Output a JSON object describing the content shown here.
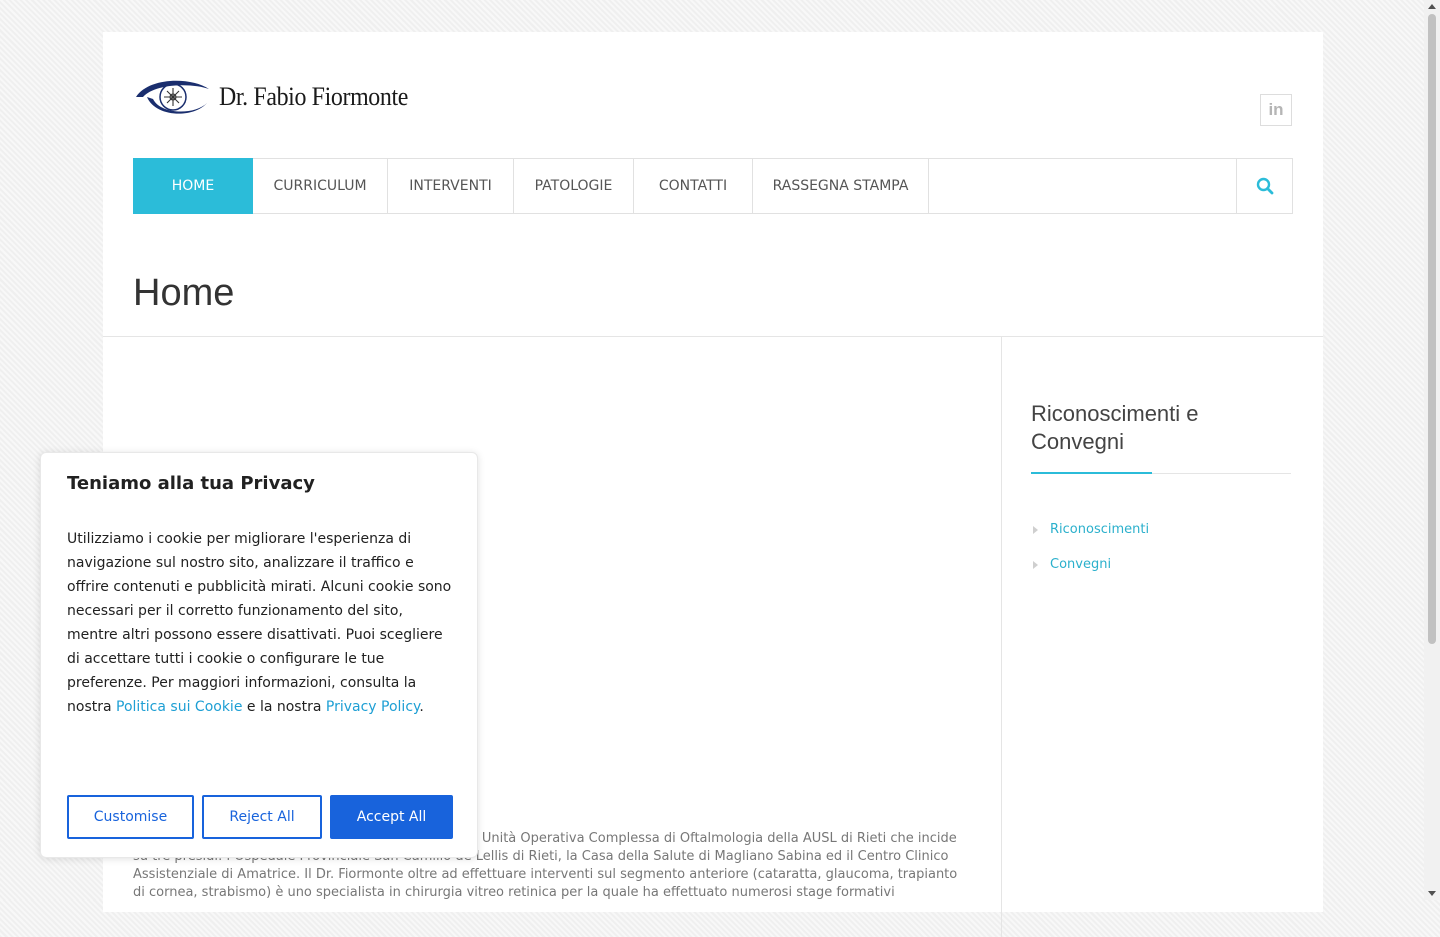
{
  "header": {
    "logo_text": "Dr. Fabio Fiormonte",
    "social_linkedin": "in"
  },
  "nav": {
    "items": [
      {
        "label": "HOME"
      },
      {
        "label": "CURRICULUM"
      },
      {
        "label": "INTERVENTI"
      },
      {
        "label": "PATOLOGIE"
      },
      {
        "label": "CONTATTI"
      },
      {
        "label": "RASSEGNA STAMPA"
      }
    ],
    "active_index": 0,
    "search_icon": "search-icon"
  },
  "page": {
    "title": "Home",
    "body_text": "001 l’ Unità Operativa Complessa di Oftalmologia della AUSL di Rieti che incide su tre presidi: l’Ospedale Provinciale San Camillo de Lellis di Rieti, la Casa della Salute di Magliano Sabina ed il Centro Clinico Assistenziale di Amatrice. Il Dr. Fiormonte oltre ad effettuare interventi sul segmento anteriore (cataratta, glaucoma, trapianto di cornea, strabismo) è uno specialista in chirurgia vitreo retinica per la quale ha effettuato numerosi stage formativi"
  },
  "sidebar": {
    "title": "Riconoscimenti e Convegni",
    "links": [
      {
        "label": "Riconoscimenti"
      },
      {
        "label": "Convegni"
      }
    ]
  },
  "cookie_banner": {
    "title": "Teniamo alla tua Privacy",
    "text_before": "Utilizziamo i cookie per migliorare l'esperienza di navigazione sul nostro sito, analizzare il traffico e offrire contenuti e pubblicità mirati. Alcuni cookie sono necessari per il corretto funzionamento del sito, mentre altri possono essere disattivati. Puoi scegliere di accettare tutti i cookie o configurare le tue preferenze. Per maggiori informazioni, consulta la nostra ",
    "link_cookie": "Politica sui Cookie",
    "text_middle": " e la nostra ",
    "link_privacy": "Privacy Policy",
    "text_after": ".",
    "buttons": {
      "customise": "Customise",
      "reject": "Reject All",
      "accept": "Accept All"
    }
  },
  "colors": {
    "accent": "#2bbcd9",
    "cookie_button": "#1863dc",
    "logo_eye": "#1a2e6e"
  }
}
